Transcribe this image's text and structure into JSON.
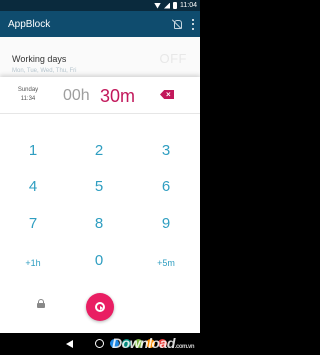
{
  "status_bar": {
    "time": "11:04"
  },
  "app_bar": {
    "title": "AppBlock"
  },
  "background_card": {
    "title": "Working days",
    "toggle": "OFF",
    "days": "Mon, Tue, Wed, Thu, Fri"
  },
  "dialog": {
    "day": "Sunday",
    "current_time": "11:34",
    "hours": "00h",
    "minutes": "30m",
    "keys": {
      "k1": "1",
      "k2": "2",
      "k3": "3",
      "k4": "4",
      "k5": "5",
      "k6": "6",
      "k7": "7",
      "k8": "8",
      "k9": "9",
      "plus1h": "+1h",
      "k0": "0",
      "plus5m": "+5m"
    }
  },
  "colors": {
    "accent": "#e91e63",
    "key_text": "#2f9ec1",
    "app_bar": "#0f4c6e"
  },
  "icons": {
    "lock": "lock-icon",
    "start": "play-icon",
    "backspace": "backspace-icon"
  },
  "nav_bar": {
    "watermark": "Download",
    "watermark_domain": ".com.vn",
    "dots": [
      "#1e88e5",
      "#00897b",
      "#7cb342",
      "#fb8c00",
      "#e53935"
    ]
  }
}
